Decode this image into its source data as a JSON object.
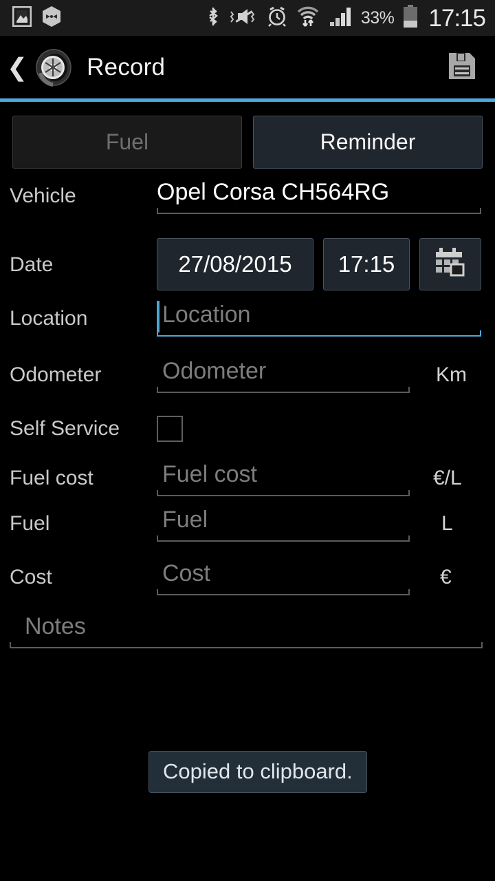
{
  "statusbar": {
    "left_icons": [
      "screenshot-image-icon",
      "hexagon-app-icon"
    ],
    "right_icons": [
      "bluetooth-icon",
      "volume-mute-vibrate-icon",
      "alarm-clock-icon",
      "wifi-transfer-icon",
      "cellular-signal-icon"
    ],
    "battery_percent": "33%",
    "clock": "17:15"
  },
  "actionbar": {
    "back_label": "❮",
    "logo_icon": "tire-wheel-logo",
    "title": "Record",
    "save_icon": "save-floppy-icon"
  },
  "tabs": [
    {
      "label": "Fuel",
      "active": false
    },
    {
      "label": "Reminder",
      "active": true
    }
  ],
  "form": {
    "vehicle": {
      "label": "Vehicle",
      "value": "Opel Corsa CH564RG",
      "placeholder": "Vehicle"
    },
    "date": {
      "label": "Date",
      "date_value": "27/08/2015",
      "time_value": "17:15",
      "picker_icon": "calendar-icon"
    },
    "location": {
      "label": "Location",
      "value": "",
      "placeholder": "Location",
      "focused": true
    },
    "odometer": {
      "label": "Odometer",
      "value": "",
      "placeholder": "Odometer",
      "unit": "Km"
    },
    "self_service": {
      "label": "Self Service",
      "checked": false
    },
    "fuel_cost": {
      "label": "Fuel cost",
      "value": "",
      "placeholder": "Fuel cost",
      "unit": "€/L"
    },
    "fuel": {
      "label": "Fuel",
      "value": "",
      "placeholder": "Fuel",
      "unit": "L"
    },
    "cost": {
      "label": "Cost",
      "value": "",
      "placeholder": "Cost",
      "unit": "€"
    },
    "notes": {
      "value": "",
      "placeholder": "Notes"
    }
  },
  "toast": {
    "message": "Copied to clipboard."
  },
  "colors": {
    "accent": "#4ea6d9",
    "background": "#000000",
    "statusbar_bg": "#1b1b1b",
    "tab_active_bg": "#1f262e",
    "tab_inactive_bg": "#1a1a1a",
    "toast_bg": "#222e38",
    "placeholder_text": "#7d7d7d",
    "label_text": "#c9c9c9"
  }
}
